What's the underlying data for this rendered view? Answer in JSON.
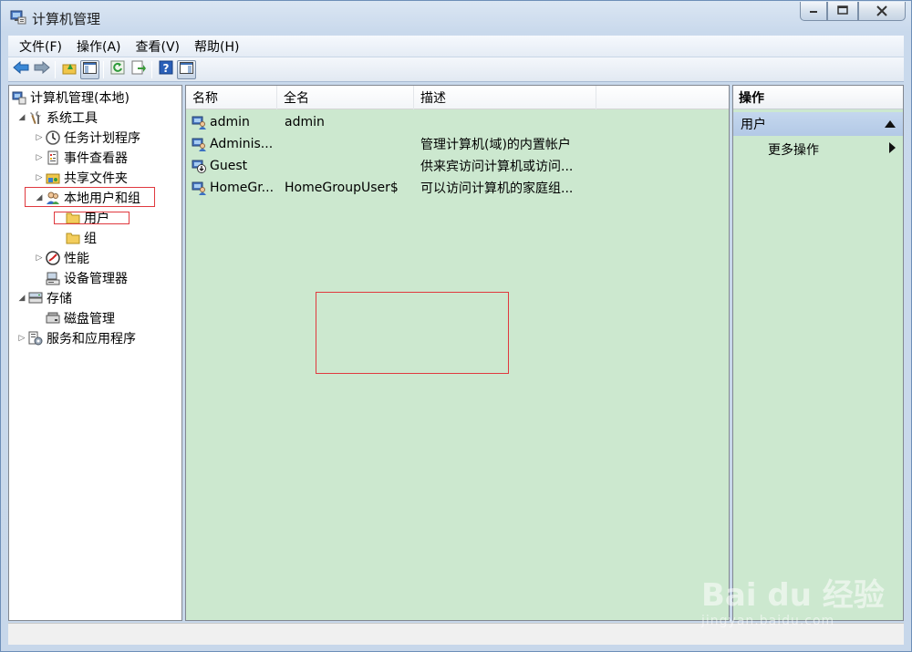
{
  "window": {
    "title": "计算机管理"
  },
  "menubar": [
    {
      "label": "文件(F)"
    },
    {
      "label": "操作(A)"
    },
    {
      "label": "查看(V)"
    },
    {
      "label": "帮助(H)"
    }
  ],
  "tree": {
    "root": "计算机管理(本地)",
    "system_tools": "系统工具",
    "task_scheduler": "任务计划程序",
    "event_viewer": "事件查看器",
    "shared_folders": "共享文件夹",
    "local_users_groups": "本地用户和组",
    "users": "用户",
    "groups": "组",
    "performance": "性能",
    "device_manager": "设备管理器",
    "storage": "存储",
    "disk_management": "磁盘管理",
    "services_apps": "服务和应用程序"
  },
  "list": {
    "columns": [
      "名称",
      "全名",
      "描述"
    ],
    "rows": [
      {
        "name": "admin",
        "full_name": "admin",
        "description": ""
      },
      {
        "name": "Adminis...",
        "full_name": "",
        "description": "管理计算机(域)的内置帐户"
      },
      {
        "name": "Guest",
        "full_name": "",
        "description": "供来宾访问计算机或访问..."
      },
      {
        "name": "HomeGr...",
        "full_name": "HomeGroupUser$",
        "description": "可以访问计算机的家庭组..."
      }
    ]
  },
  "actions": {
    "title": "操作",
    "group": "用户",
    "more": "更多操作"
  },
  "watermark": {
    "brand": "Bai du 经验",
    "url": "jingyan.baidu.com"
  }
}
